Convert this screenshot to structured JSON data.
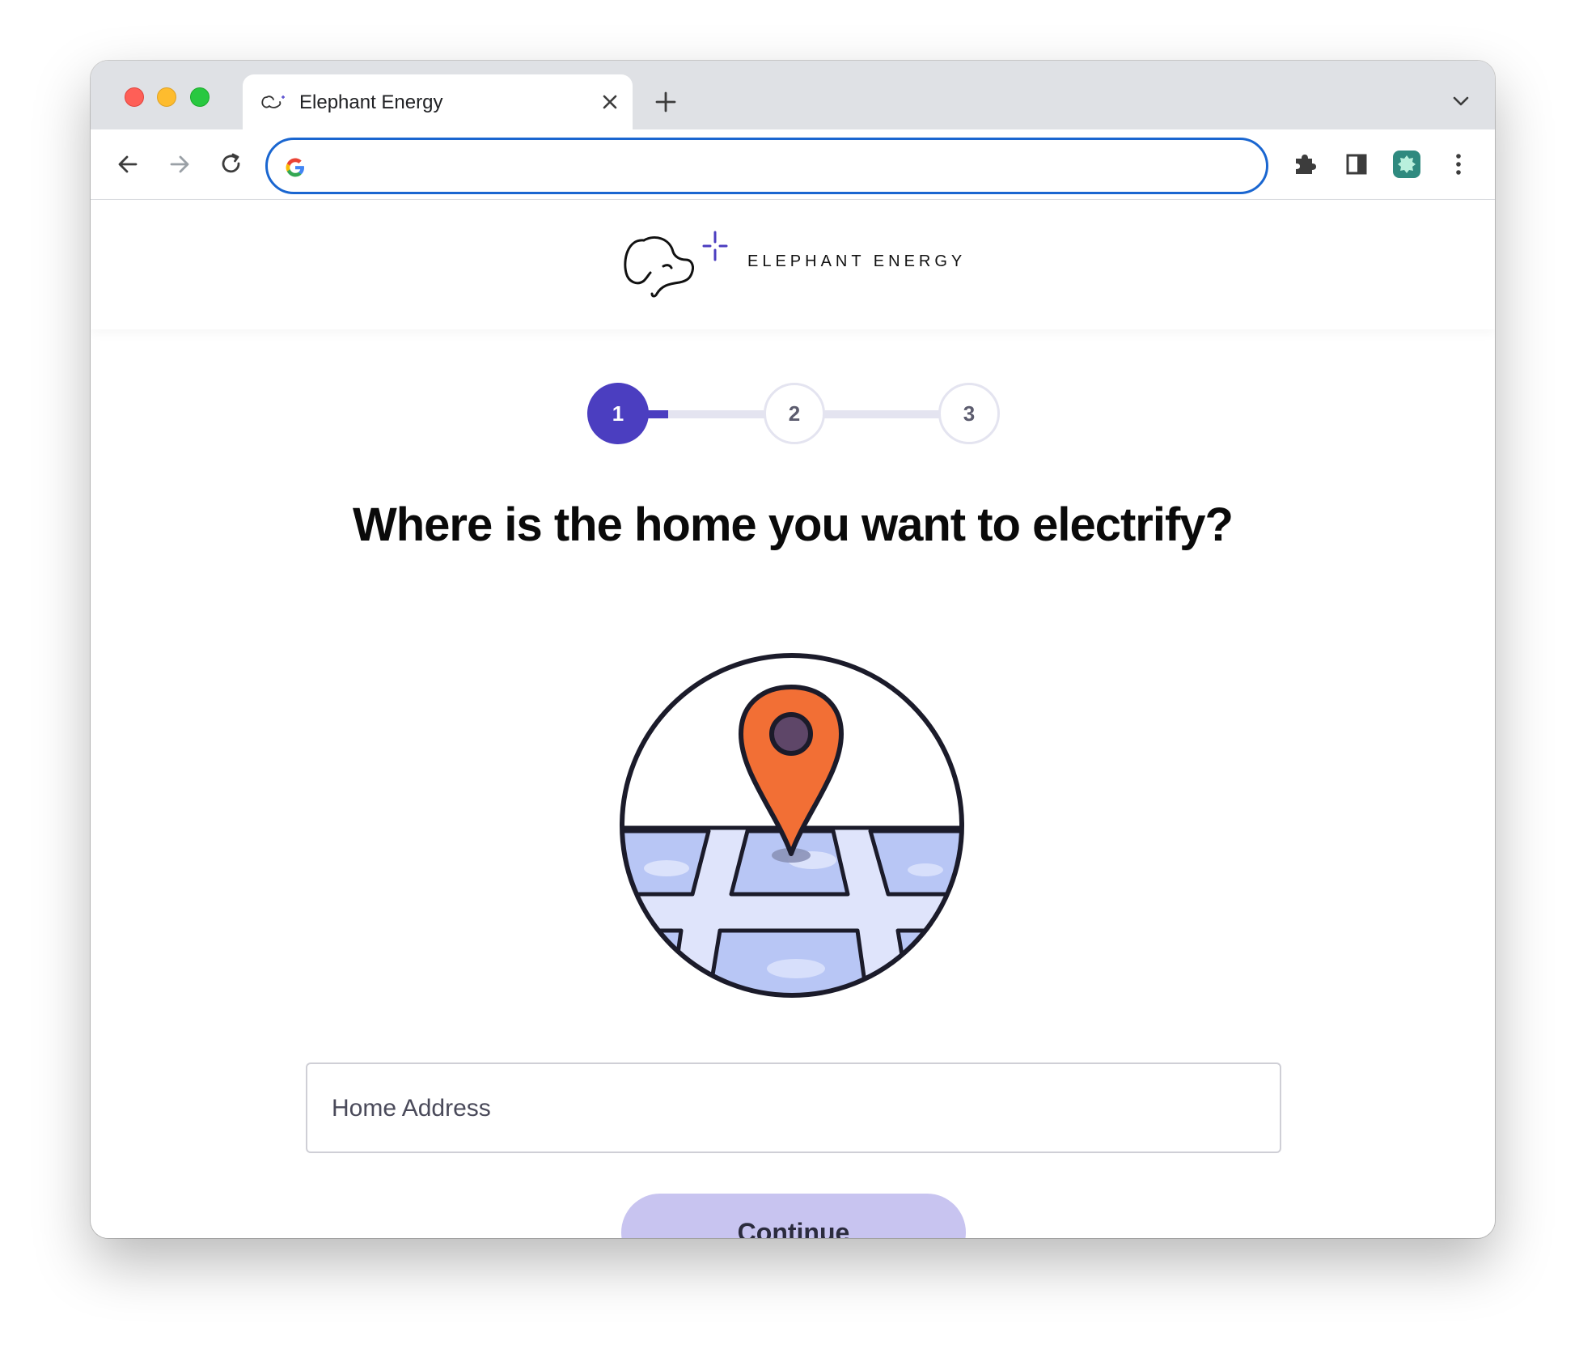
{
  "browser": {
    "tab": {
      "title": "Elephant Energy"
    },
    "omnibox": {
      "value": "",
      "placeholder": ""
    }
  },
  "site": {
    "brand": "ELEPHANT ENERGY"
  },
  "stepper": {
    "steps": [
      "1",
      "2",
      "3"
    ],
    "current_step": 1
  },
  "form": {
    "question": "Where is the home you want to electrify?",
    "address_placeholder": "Home Address",
    "address_value": "",
    "continue_label": "Continue"
  },
  "colors": {
    "accent": "#4b3ec0",
    "button_disabled": "#c8c4f0",
    "pin": "#f26f35",
    "map_block": "#b8c6f5",
    "map_road": "#dfe4fb"
  },
  "icons": {
    "traffic_lights": [
      "close",
      "minimize",
      "zoom"
    ],
    "tab": [
      "elephant-favicon",
      "close-icon"
    ],
    "toolbar": [
      "back-arrow-icon",
      "forward-arrow-icon",
      "reload-icon",
      "google-g-icon",
      "puzzle-icon",
      "sidepanel-icon",
      "extension-icon",
      "more-vert-icon"
    ]
  }
}
